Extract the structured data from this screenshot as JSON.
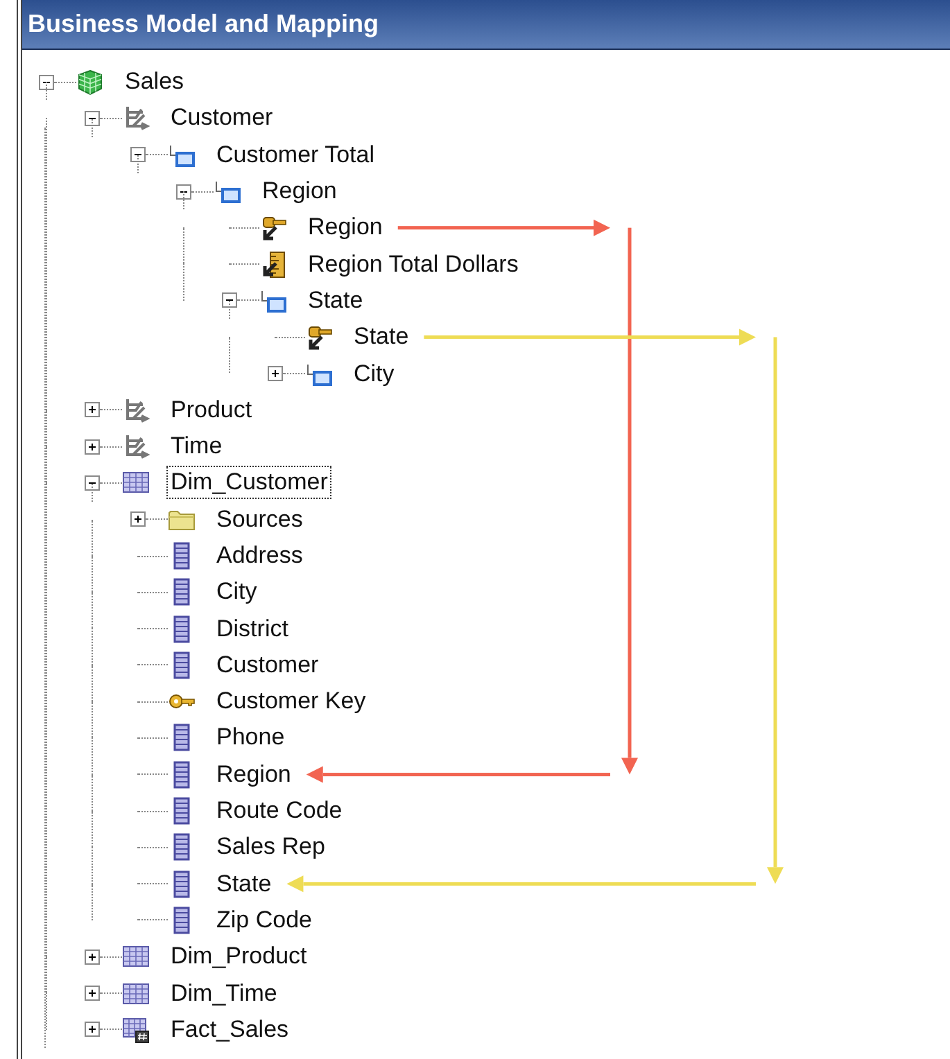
{
  "window": {
    "title": "Business Model and Mapping"
  },
  "tree": [
    {
      "label": "Sales",
      "kind": "business-model",
      "expanded": true,
      "selected": false,
      "children": [
        {
          "label": "Customer",
          "kind": "dimension",
          "expanded": true,
          "selected": false,
          "children": [
            {
              "label": "Customer Total",
              "kind": "level",
              "expanded": true,
              "selected": false,
              "children": [
                {
                  "label": "Region",
                  "kind": "level",
                  "expanded": true,
                  "selected": false,
                  "children": [
                    {
                      "label": "Region",
                      "kind": "level-key",
                      "selected": false,
                      "arrow_start": true
                    },
                    {
                      "label": "Region Total Dollars",
                      "kind": "measure",
                      "selected": false
                    },
                    {
                      "label": "State",
                      "kind": "level",
                      "expanded": true,
                      "selected": false,
                      "children": [
                        {
                          "label": "State",
                          "kind": "level-key",
                          "selected": false,
                          "arrow_start": true
                        },
                        {
                          "label": "City",
                          "kind": "level",
                          "expanded": false,
                          "selected": false
                        }
                      ]
                    }
                  ]
                }
              ]
            }
          ]
        },
        {
          "label": "Product",
          "kind": "dimension",
          "expanded": false,
          "selected": false
        },
        {
          "label": "Time",
          "kind": "dimension",
          "expanded": false,
          "selected": false
        },
        {
          "label": "Dim_Customer",
          "kind": "table",
          "expanded": true,
          "selected": true,
          "children": [
            {
              "label": "Sources",
              "kind": "folder",
              "expanded": false,
              "selected": false
            },
            {
              "label": "Address",
              "kind": "column",
              "selected": false
            },
            {
              "label": "City",
              "kind": "column",
              "selected": false
            },
            {
              "label": "District",
              "kind": "column",
              "selected": false
            },
            {
              "label": "Customer",
              "kind": "column",
              "selected": false
            },
            {
              "label": "Customer Key",
              "kind": "primary-key",
              "selected": false
            },
            {
              "label": "Phone",
              "kind": "column",
              "selected": false
            },
            {
              "label": "Region",
              "kind": "column",
              "selected": false,
              "arrow_end": true
            },
            {
              "label": "Route Code",
              "kind": "column",
              "selected": false
            },
            {
              "label": "Sales Rep",
              "kind": "column",
              "selected": false
            },
            {
              "label": "State",
              "kind": "column",
              "selected": false,
              "arrow_end": true
            },
            {
              "label": "Zip Code",
              "kind": "column",
              "selected": false
            }
          ]
        },
        {
          "label": "Dim_Product",
          "kind": "table",
          "expanded": false,
          "selected": false
        },
        {
          "label": "Dim_Time",
          "kind": "table",
          "expanded": false,
          "selected": false
        },
        {
          "label": "Fact_Sales",
          "kind": "fact-table",
          "expanded": false,
          "selected": false
        }
      ]
    }
  ],
  "mapping_arrows": [
    {
      "color": "#f26451"
    },
    {
      "color": "#eedc55"
    }
  ]
}
